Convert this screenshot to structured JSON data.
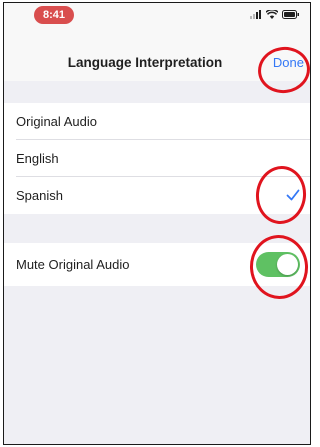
{
  "status_bar": {
    "time": "8:41",
    "icons": [
      "signal-icon",
      "wifi-icon",
      "battery-icon"
    ]
  },
  "nav": {
    "title": "Language Interpretation",
    "done_label": "Done"
  },
  "languages": [
    {
      "label": "Original Audio",
      "selected": false
    },
    {
      "label": "English",
      "selected": false
    },
    {
      "label": "Spanish",
      "selected": true
    }
  ],
  "settings": {
    "mute_label": "Mute Original Audio",
    "mute_enabled": true
  },
  "colors": {
    "accent": "#3478f6",
    "toggle_on": "#5fc163",
    "annotation": "#e0141e",
    "time_pill": "#d94e4e"
  }
}
